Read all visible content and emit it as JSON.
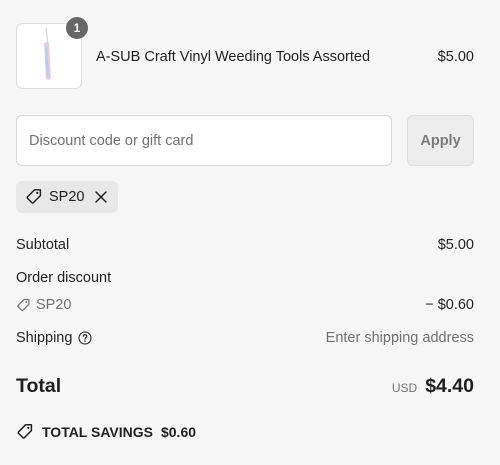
{
  "cart": {
    "items": [
      {
        "quantity": "1",
        "title": "A-SUB Craft Vinyl Weeding Tools Assorted",
        "price": "$5.00",
        "image_icon": "weeding-tool-icon"
      }
    ]
  },
  "discount": {
    "placeholder": "Discount code or gift card",
    "value": "",
    "apply_label": "Apply",
    "applied_code": "SP20",
    "tag_icon": "tag-icon",
    "remove_icon": "close-icon"
  },
  "summary": {
    "subtotal_label": "Subtotal",
    "subtotal_value": "$5.00",
    "order_discount_label": "Order discount",
    "discount_code": "SP20",
    "discount_value": "− $0.60",
    "shipping_label": "Shipping",
    "shipping_help_icon": "help-circle-icon",
    "shipping_value": "Enter shipping address",
    "total_label": "Total",
    "currency": "USD",
    "total_value": "$4.40",
    "savings_label": "TOTAL SAVINGS",
    "savings_value": "$0.60"
  },
  "colors": {
    "background": "#f6f6f6",
    "text": "#1f1f1f",
    "muted_text": "#707070",
    "badge": "#666666",
    "chip_background": "#e8e8e8",
    "apply_button_background": "#ededed"
  }
}
